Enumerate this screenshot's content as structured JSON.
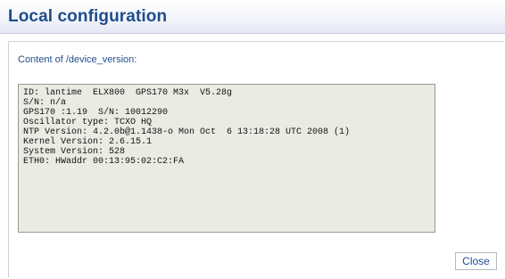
{
  "header": {
    "title": "Local configuration"
  },
  "content": {
    "label": "Content of /device_version:",
    "lines": [
      "ID: lantime  ELX800  GPS170 M3x  V5.28g",
      "S/N: n/a",
      "GPS170 :1.19  S/N: 10012290",
      "Oscillator type: TCXO HQ",
      "NTP Version: 4.2.0b@1.1438-o Mon Oct  6 13:18:28 UTC 2008 (1)",
      "Kernel Version: 2.6.15.1",
      "System Version: 528",
      "ETH0: HWaddr 00:13:95:02:C2:FA"
    ]
  },
  "footer": {
    "close_label": "Close"
  },
  "colors": {
    "title": "#1f4d8c",
    "output_background": "#ebebe4"
  }
}
